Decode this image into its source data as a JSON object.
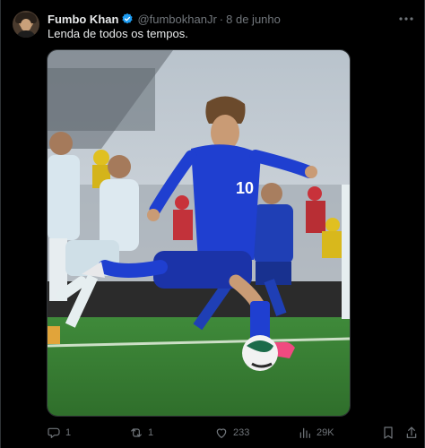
{
  "tweet": {
    "author_name": "Fumbo Khan",
    "handle": "@fumbokhanJr",
    "separator": "·",
    "date": "8 de junho",
    "text": "Lenda de todos os tempos.",
    "media_icon": "photo-football-penalty",
    "colors": {
      "background": "#000000",
      "text": "#e7e9ea",
      "muted": "#71767b",
      "verified": "#1d9bf0",
      "border": "#2f3336"
    }
  },
  "actions": {
    "replies": "1",
    "retweets": "1",
    "likes": "233",
    "views": "29K"
  }
}
